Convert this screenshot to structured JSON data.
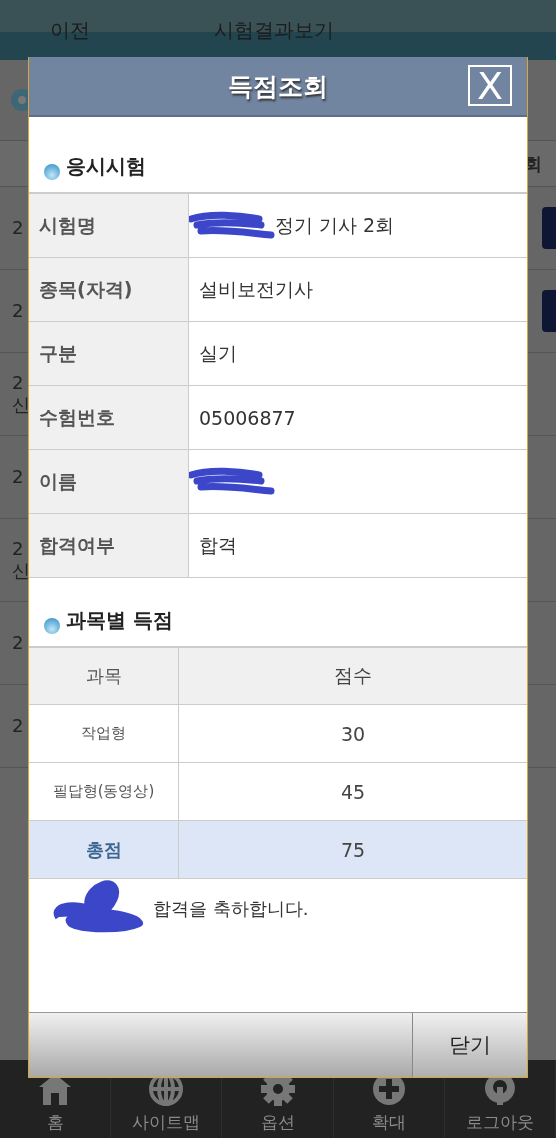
{
  "header": {
    "back": "이전",
    "title": "시험결과보기"
  },
  "background_table": {
    "last_column_header": "회",
    "rows": [
      {
        "column_1": "2",
        "button": true
      },
      {
        "column_1": "2",
        "button": true
      },
      {
        "column_1": "2",
        "column_1_line_2": "신",
        "button": false
      },
      {
        "column_1": "2",
        "button": false
      },
      {
        "column_1": "2",
        "column_1_line_2": "신",
        "button": false
      },
      {
        "column_1": "2",
        "button": false
      },
      {
        "column_1": "2",
        "button": false
      }
    ]
  },
  "dialog": {
    "title": "득점조회",
    "close_icon": "X",
    "exam_section": {
      "heading": "응시시험",
      "rows": [
        {
          "label": "시험명",
          "value": "정기 기사 2회",
          "redacted": true
        },
        {
          "label": "종목(자격)",
          "value": "설비보전기사",
          "redacted": false
        },
        {
          "label": "구분",
          "value": "실기",
          "redacted": false
        },
        {
          "label": "수험번호",
          "value": "05006877",
          "redacted": false
        },
        {
          "label": "이름",
          "redacted": true
        },
        {
          "label": "합격여부",
          "value": "합격",
          "redacted": false
        }
      ]
    },
    "score_section": {
      "heading": "과목별 득점",
      "columns": [
        "과목",
        "점수"
      ],
      "rows": [
        {
          "subject": "작업형",
          "score": "30",
          "kind": "subject"
        },
        {
          "subject": "필답형(동영상)",
          "score": "45",
          "kind": "subject"
        },
        {
          "subject": "총점",
          "score": "75",
          "kind": "total"
        }
      ]
    },
    "message": {
      "text": "합격을 축하합니다.",
      "redacted": true
    },
    "close_button": "닫기"
  },
  "bottom_nav": [
    {
      "label": "홈",
      "kind": "home"
    },
    {
      "label": "사이트맵",
      "kind": "globe"
    },
    {
      "label": "옵션",
      "kind": "gear"
    },
    {
      "label": "확대",
      "kind": "plus"
    },
    {
      "label": "로그아웃",
      "kind": "power"
    }
  ]
}
